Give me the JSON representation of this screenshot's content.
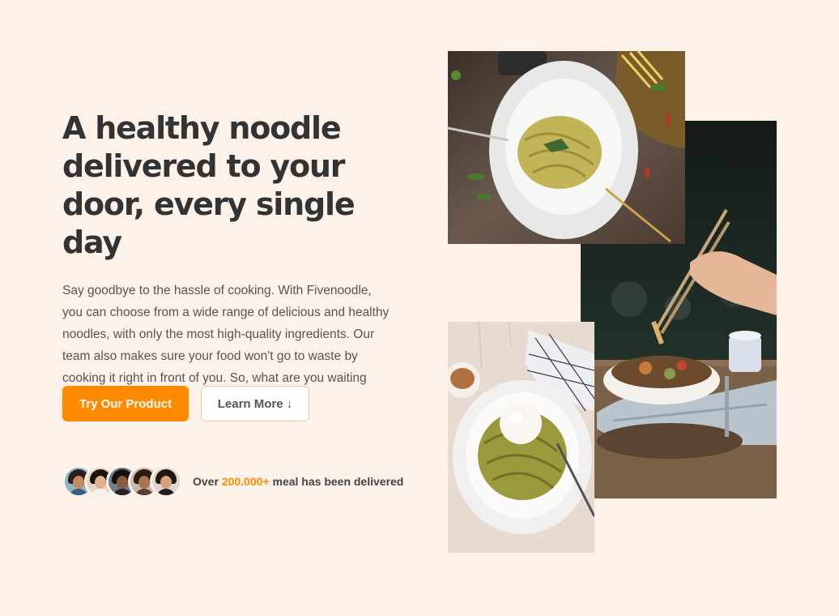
{
  "hero": {
    "headline": "A healthy noodle delivered to your door, every single day",
    "description": "Say goodbye to the hassle of cooking. With Fivenoodle, you can choose from a wide range of delicious and healthy noodles, with only the most high-quality ingredients. Our team also makes sure your food won't go to waste by cooking it right in front of you. So, what are you waiting for?"
  },
  "buttons": {
    "primary_label": "Try Our Product",
    "secondary_label": "Learn More ↓"
  },
  "delivered": {
    "prefix": "Over",
    "count": "200.000+",
    "suffix": "meal has been delivered"
  },
  "colors": {
    "background": "#fdf2e9",
    "accent": "#ff8a00",
    "text": "#333333"
  },
  "images": [
    {
      "name": "green-pasta-plate-photo"
    },
    {
      "name": "noodle-bowl-chopsticks-photo"
    },
    {
      "name": "burrata-spaghetti-photo"
    }
  ]
}
